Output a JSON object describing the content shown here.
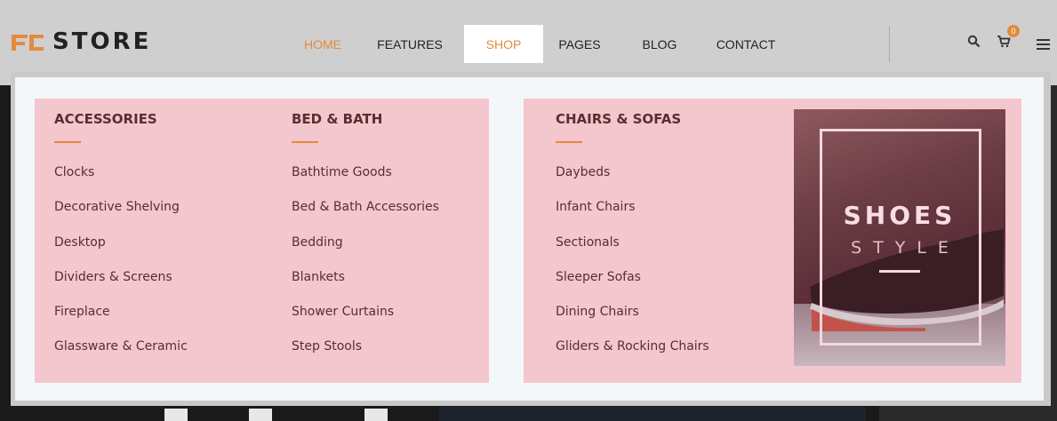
{
  "brand": {
    "name": "STORE",
    "accent": "#e38a3d"
  },
  "nav": {
    "items": [
      {
        "label": "HOME"
      },
      {
        "label": "FEATURES"
      },
      {
        "label": "SHOP"
      },
      {
        "label": "PAGES"
      },
      {
        "label": "BLOG"
      },
      {
        "label": "CONTACT"
      }
    ],
    "active": "SHOP"
  },
  "header_icons": {
    "search": "search-icon",
    "cart": "cart-icon",
    "cart_count": "0",
    "menu": "hamburger-menu-icon"
  },
  "mega_menu": {
    "columns": [
      {
        "title": "ACCESSORIES",
        "links": [
          "Clocks",
          "Decorative Shelving",
          "Desktop",
          "Dividers & Screens",
          "Fireplace",
          "Glassware & Ceramic"
        ]
      },
      {
        "title": "BED & BATH",
        "links": [
          "Bathtime Goods",
          "Bed & Bath Accessories",
          "Bedding",
          "Blankets",
          "Shower Curtains",
          "Step Stools"
        ]
      },
      {
        "title": "CHAIRS & SOFAS",
        "links": [
          "Daybeds",
          "Infant Chairs",
          "Sectionals",
          "Sleeper Sofas",
          "Dining Chairs",
          "Gliders & Rocking Chairs"
        ]
      }
    ],
    "promo": {
      "title": "SHOES",
      "subtitle": "STYLE"
    },
    "colors": {
      "panel": "#f4c6cd",
      "text": "#5a2d2f",
      "underline": "#e38a3d"
    }
  }
}
